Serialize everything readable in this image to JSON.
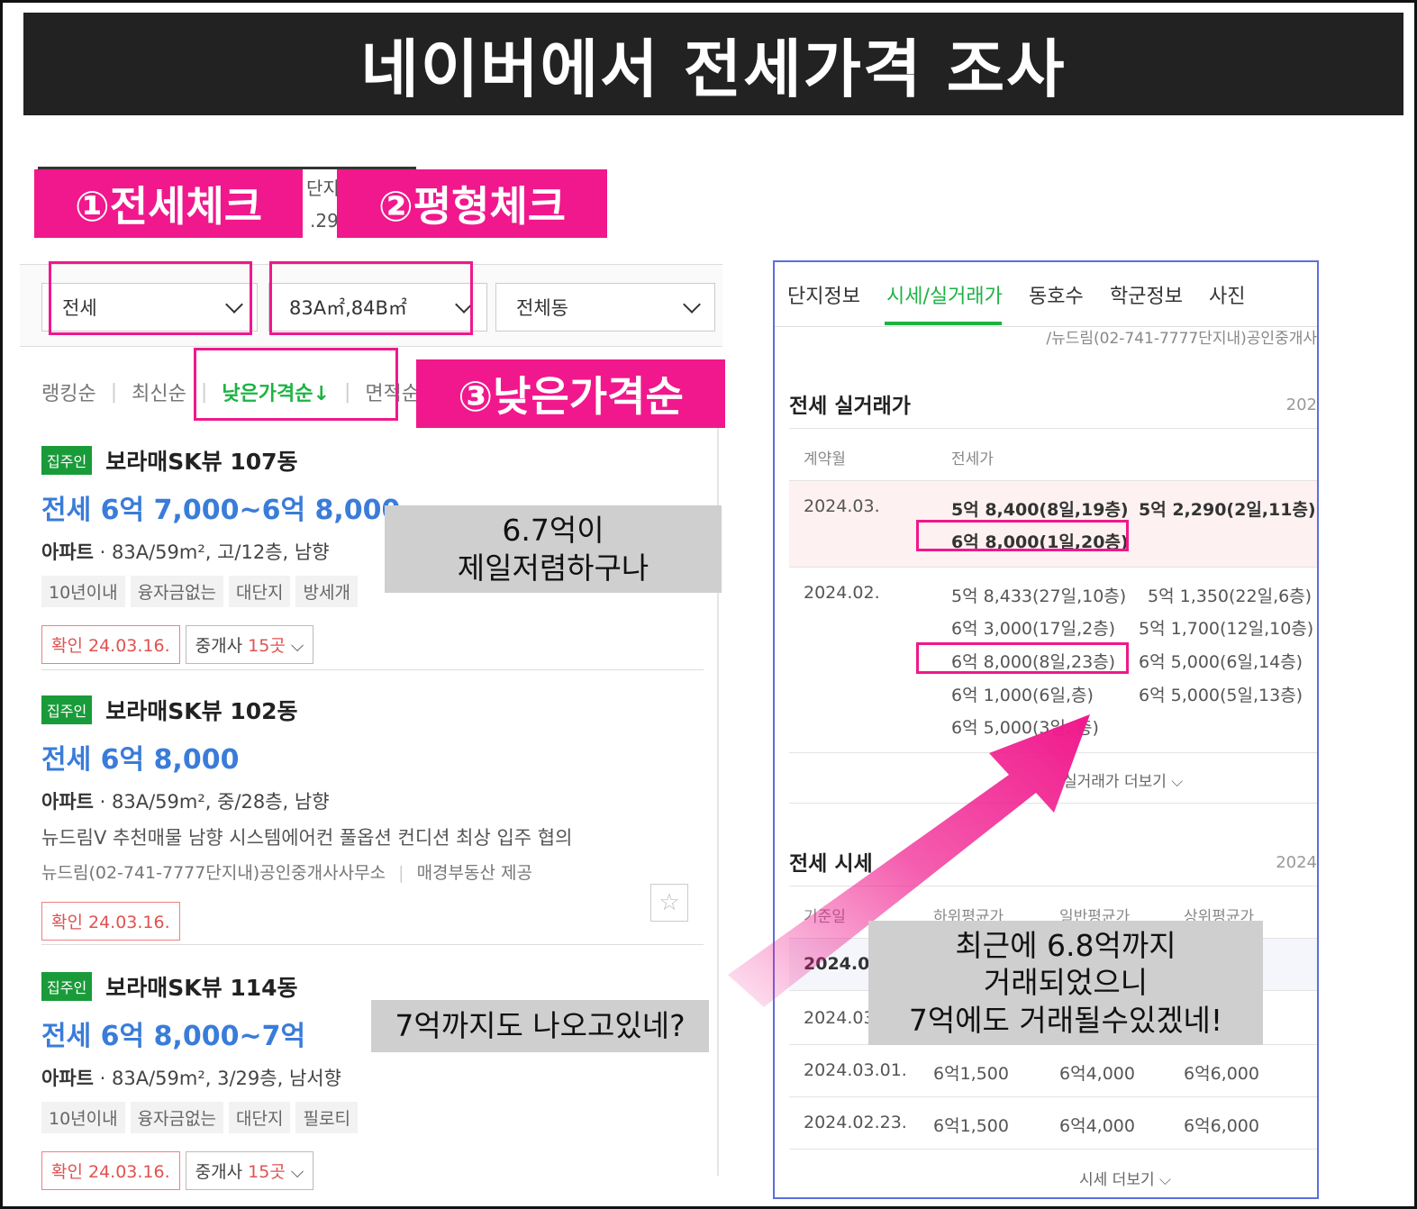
{
  "title": "네이버에서 전세가격 조사",
  "labels": {
    "step1": "①전세체크",
    "step2": "②평형체크",
    "step3": "③낮은가격순"
  },
  "filters": {
    "deal_type": "전세",
    "area": "83A㎡,84B㎡",
    "dong": "전체동"
  },
  "cut_text": {
    "a": "단지정",
    "b": ".29"
  },
  "sort": {
    "items": [
      "랭킹순",
      "최신순",
      "낮은가격순↓",
      "면적순"
    ],
    "active_index": 2
  },
  "listings": [
    {
      "badge": "집주인",
      "title": "보라매SK뷰 107동",
      "price": "전세 6억 7,000~6억 8,000",
      "type": "아파트",
      "info": "83A/59m², 고/12층, 남향",
      "tags": [
        "10년이내",
        "융자금없는",
        "대단지",
        "방세개"
      ],
      "confirm": "확인 24.03.16.",
      "agent_prefix": "중개사 ",
      "agent_count": "15곳"
    },
    {
      "badge": "집주인",
      "title": "보라매SK뷰 102동",
      "price": "전세 6억 8,000",
      "type": "아파트",
      "info": "83A/59m², 중/28층, 남향",
      "desc": "뉴드림V 추천매물 남향 시스템에어컨 풀옵션 컨디션 최상 입주 협의",
      "source": "뉴드림(02-741-7777단지내)공인중개사사무소",
      "source2": "매경부동산 제공",
      "confirm": "확인 24.03.16."
    },
    {
      "badge": "집주인",
      "title": "보라매SK뷰 114동",
      "price": "전세 6억 8,000~7억",
      "type": "아파트",
      "info": "83A/59m², 3/29층, 남서향",
      "tags": [
        "10년이내",
        "융자금없는",
        "대단지",
        "필로티"
      ],
      "confirm": "확인 24.03.16.",
      "agent_prefix": "중개사 ",
      "agent_count": "15곳"
    }
  ],
  "notes": {
    "cheapest_1": "6.7억이",
    "cheapest_2": "제일저렴하구나",
    "up_to_7": "7억까지도 나오고있네?",
    "recent_1": "최근에 6.8억까지",
    "recent_2": "거래되었으니",
    "recent_3": "7억에도 거래될수있겠네!"
  },
  "right_panel": {
    "tabs": [
      "단지정보",
      "시세/실거래가",
      "동호수",
      "학군정보",
      "사진"
    ],
    "active_tab": 1,
    "path": "/뉴드림(02-741-7777단지내)공인중개사",
    "real_deal": {
      "title": "전세 실거래가",
      "year": "202",
      "col_month": "계약월",
      "col_price": "전세가",
      "rows": [
        {
          "month": "2024.03.",
          "entries": [
            "5억 8,400(8일,19층)",
            "5억 2,290(2일,11층)",
            "6억 8,000(1일,20층)"
          ]
        },
        {
          "month": "2024.02.",
          "entries": [
            "5억 8,433(27일,10층)",
            "5억 1,350(22일,6층)",
            "6억 3,000(17일,2층)",
            "5억 1,700(12일,10층)",
            "6억 8,000(8일,23층)",
            "6억 5,000(6일,14층)",
            "6억 1,000(6일,층)",
            "6억 5,000(5일,13층)",
            "6억 5,000(3일, 층)"
          ]
        }
      ],
      "more": "실거래가 더보기"
    },
    "market": {
      "title": "전세 시세",
      "year": "2024",
      "cols": [
        "기준일",
        "하위평균가",
        "일반평균가",
        "상위평균가"
      ],
      "rows": [
        [
          "2024.03",
          "",
          "",
          ""
        ],
        [
          "2024.03",
          "",
          "",
          ""
        ],
        [
          "2024.03.01.",
          "6억1,500",
          "6억4,000",
          "6억6,000"
        ],
        [
          "2024.02.23.",
          "6억1,500",
          "6억4,000",
          "6억6,000"
        ]
      ],
      "more": "시세 더보기"
    }
  },
  "colors": {
    "pink": "#f0188c",
    "green": "#1db344",
    "blue": "#3a7cd9",
    "red": "#e05252"
  }
}
